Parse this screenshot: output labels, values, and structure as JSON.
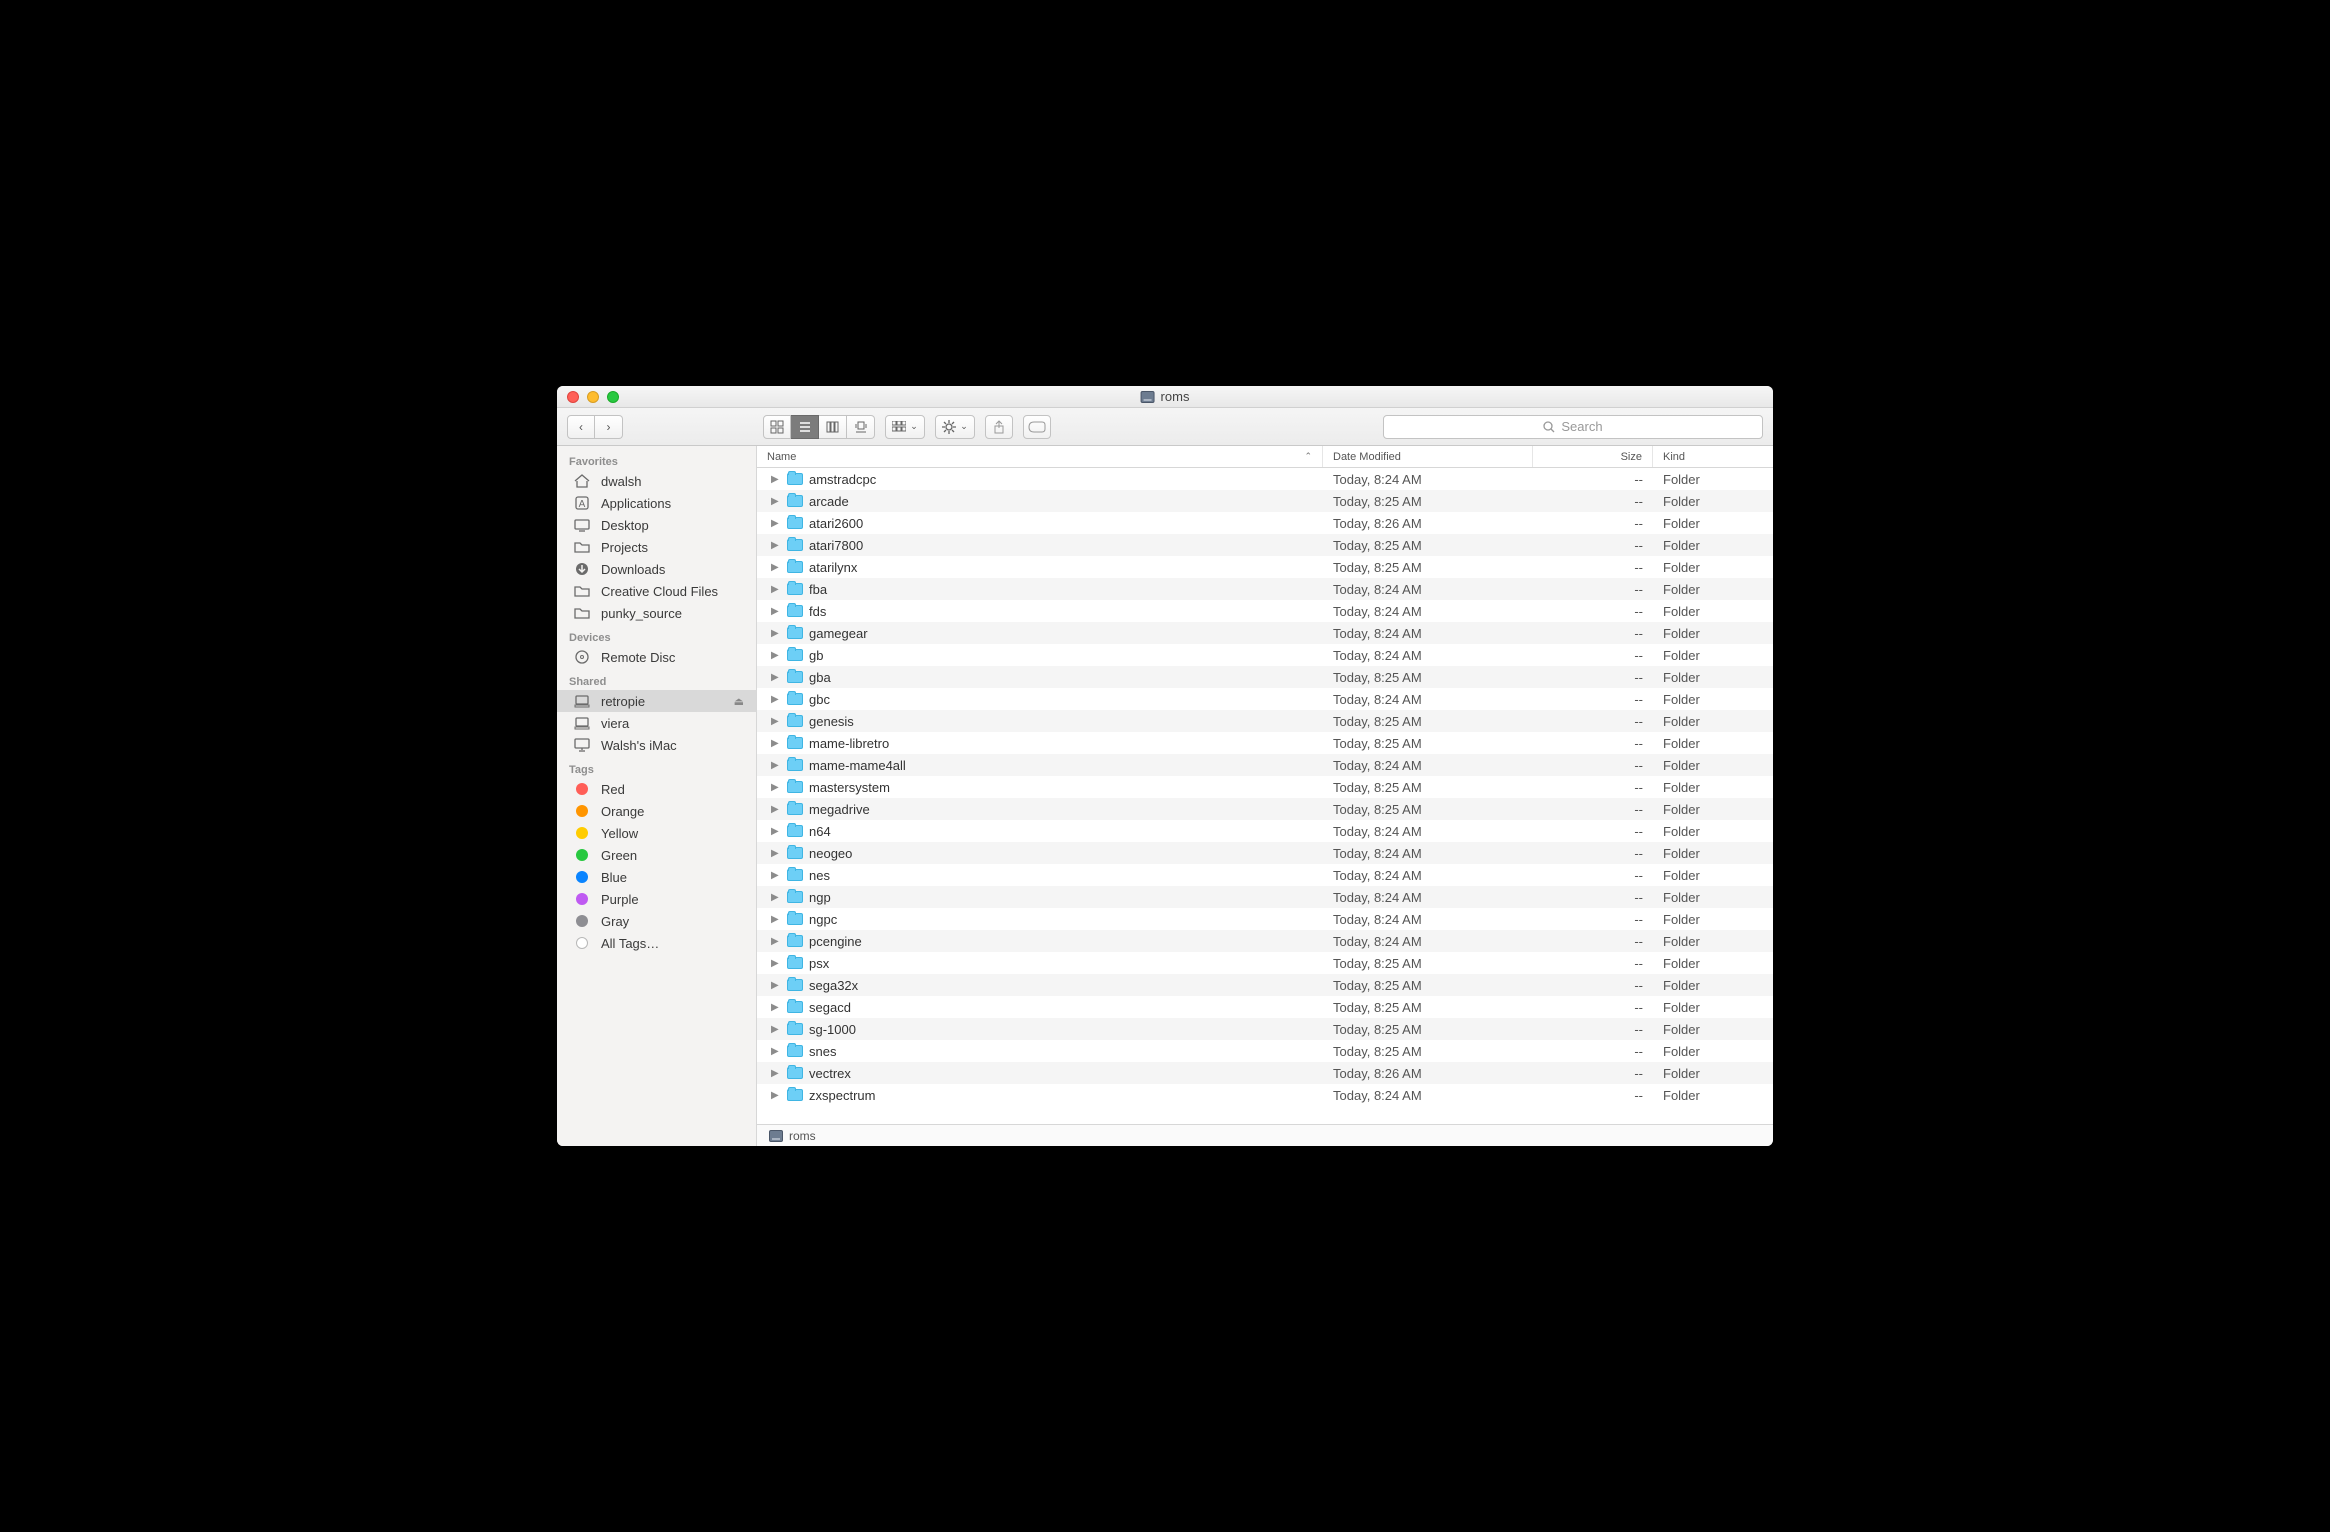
{
  "window": {
    "title": "roms"
  },
  "search": {
    "placeholder": "Search"
  },
  "columns": {
    "name": "Name",
    "date": "Date Modified",
    "size": "Size",
    "kind": "Kind"
  },
  "pathbar": {
    "label": "roms"
  },
  "sidebar": {
    "sections": [
      {
        "heading": "Favorites",
        "items": [
          {
            "icon": "home",
            "label": "dwalsh"
          },
          {
            "icon": "apps",
            "label": "Applications"
          },
          {
            "icon": "desktop",
            "label": "Desktop"
          },
          {
            "icon": "folder",
            "label": "Projects"
          },
          {
            "icon": "downloads",
            "label": "Downloads"
          },
          {
            "icon": "folder",
            "label": "Creative Cloud Files"
          },
          {
            "icon": "folder",
            "label": "punky_source"
          }
        ]
      },
      {
        "heading": "Devices",
        "items": [
          {
            "icon": "disc",
            "label": "Remote Disc"
          }
        ]
      },
      {
        "heading": "Shared",
        "items": [
          {
            "icon": "pc",
            "label": "retropie",
            "eject": true,
            "selected": true
          },
          {
            "icon": "pc",
            "label": "viera"
          },
          {
            "icon": "imac",
            "label": "Walsh's iMac"
          }
        ]
      },
      {
        "heading": "Tags",
        "items": [
          {
            "icon": "tag",
            "color": "#ff5e57",
            "label": "Red"
          },
          {
            "icon": "tag",
            "color": "#ff9500",
            "label": "Orange"
          },
          {
            "icon": "tag",
            "color": "#ffcc00",
            "label": "Yellow"
          },
          {
            "icon": "tag",
            "color": "#28c840",
            "label": "Green"
          },
          {
            "icon": "tag",
            "color": "#0a84ff",
            "label": "Blue"
          },
          {
            "icon": "tag",
            "color": "#bf5af2",
            "label": "Purple"
          },
          {
            "icon": "tag",
            "color": "#8e8e93",
            "label": "Gray"
          },
          {
            "icon": "alltags",
            "label": "All Tags…"
          }
        ]
      }
    ]
  },
  "rows": [
    {
      "name": "amstradcpc",
      "date": "Today, 8:24 AM",
      "size": "--",
      "kind": "Folder"
    },
    {
      "name": "arcade",
      "date": "Today, 8:25 AM",
      "size": "--",
      "kind": "Folder"
    },
    {
      "name": "atari2600",
      "date": "Today, 8:26 AM",
      "size": "--",
      "kind": "Folder"
    },
    {
      "name": "atari7800",
      "date": "Today, 8:25 AM",
      "size": "--",
      "kind": "Folder"
    },
    {
      "name": "atarilynx",
      "date": "Today, 8:25 AM",
      "size": "--",
      "kind": "Folder"
    },
    {
      "name": "fba",
      "date": "Today, 8:24 AM",
      "size": "--",
      "kind": "Folder"
    },
    {
      "name": "fds",
      "date": "Today, 8:24 AM",
      "size": "--",
      "kind": "Folder"
    },
    {
      "name": "gamegear",
      "date": "Today, 8:24 AM",
      "size": "--",
      "kind": "Folder"
    },
    {
      "name": "gb",
      "date": "Today, 8:24 AM",
      "size": "--",
      "kind": "Folder"
    },
    {
      "name": "gba",
      "date": "Today, 8:25 AM",
      "size": "--",
      "kind": "Folder"
    },
    {
      "name": "gbc",
      "date": "Today, 8:24 AM",
      "size": "--",
      "kind": "Folder"
    },
    {
      "name": "genesis",
      "date": "Today, 8:25 AM",
      "size": "--",
      "kind": "Folder"
    },
    {
      "name": "mame-libretro",
      "date": "Today, 8:25 AM",
      "size": "--",
      "kind": "Folder"
    },
    {
      "name": "mame-mame4all",
      "date": "Today, 8:24 AM",
      "size": "--",
      "kind": "Folder"
    },
    {
      "name": "mastersystem",
      "date": "Today, 8:25 AM",
      "size": "--",
      "kind": "Folder"
    },
    {
      "name": "megadrive",
      "date": "Today, 8:25 AM",
      "size": "--",
      "kind": "Folder"
    },
    {
      "name": "n64",
      "date": "Today, 8:24 AM",
      "size": "--",
      "kind": "Folder"
    },
    {
      "name": "neogeo",
      "date": "Today, 8:24 AM",
      "size": "--",
      "kind": "Folder"
    },
    {
      "name": "nes",
      "date": "Today, 8:24 AM",
      "size": "--",
      "kind": "Folder"
    },
    {
      "name": "ngp",
      "date": "Today, 8:24 AM",
      "size": "--",
      "kind": "Folder"
    },
    {
      "name": "ngpc",
      "date": "Today, 8:24 AM",
      "size": "--",
      "kind": "Folder"
    },
    {
      "name": "pcengine",
      "date": "Today, 8:24 AM",
      "size": "--",
      "kind": "Folder"
    },
    {
      "name": "psx",
      "date": "Today, 8:25 AM",
      "size": "--",
      "kind": "Folder"
    },
    {
      "name": "sega32x",
      "date": "Today, 8:25 AM",
      "size": "--",
      "kind": "Folder"
    },
    {
      "name": "segacd",
      "date": "Today, 8:25 AM",
      "size": "--",
      "kind": "Folder"
    },
    {
      "name": "sg-1000",
      "date": "Today, 8:25 AM",
      "size": "--",
      "kind": "Folder"
    },
    {
      "name": "snes",
      "date": "Today, 8:25 AM",
      "size": "--",
      "kind": "Folder"
    },
    {
      "name": "vectrex",
      "date": "Today, 8:26 AM",
      "size": "--",
      "kind": "Folder"
    },
    {
      "name": "zxspectrum",
      "date": "Today, 8:24 AM",
      "size": "--",
      "kind": "Folder"
    }
  ]
}
